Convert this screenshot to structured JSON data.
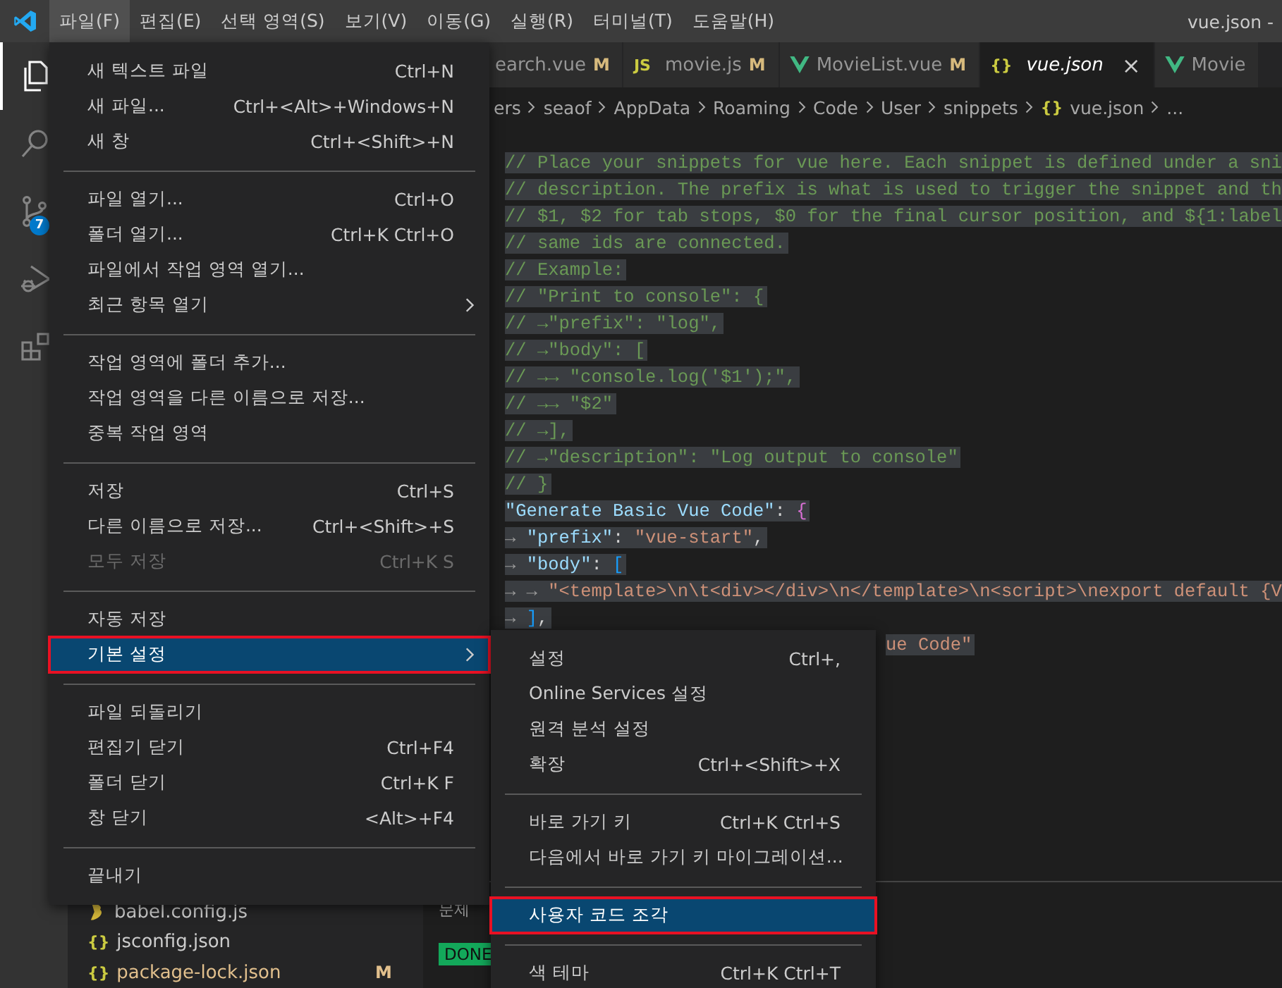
{
  "menubar": [
    {
      "label": "파일(F)",
      "selected": true
    },
    {
      "label": "편집(E)",
      "selected": false
    },
    {
      "label": "선택 영역(S)",
      "selected": false
    },
    {
      "label": "보기(V)",
      "selected": false
    },
    {
      "label": "이동(G)",
      "selected": false
    },
    {
      "label": "실행(R)",
      "selected": false
    },
    {
      "label": "터미널(T)",
      "selected": false
    },
    {
      "label": "도움말(H)",
      "selected": false
    }
  ],
  "window": {
    "title": "vue.json -"
  },
  "activity_bar": [
    {
      "kind": "files",
      "selected": true
    },
    {
      "kind": "search",
      "selected": false
    },
    {
      "kind": "scm",
      "selected": false,
      "badge": "7"
    },
    {
      "kind": "debug",
      "selected": false
    },
    {
      "kind": "extensions",
      "selected": false
    }
  ],
  "tabs": [
    {
      "label": "earch.vue",
      "status": "M",
      "kind": "plain",
      "selected": false,
      "italic": false
    },
    {
      "label": "movie.js",
      "status": "M",
      "kind": "glyph",
      "icon_text": "JS",
      "selected": false,
      "italic": false
    },
    {
      "label": "MovieList.vue",
      "status": "M",
      "kind": "vue",
      "selected": false,
      "italic": false
    },
    {
      "label": "vue.json",
      "kind": "glyph",
      "icon_text": "{}",
      "selected": true,
      "italic": true,
      "close": "×"
    },
    {
      "label": "Movie",
      "kind": "vue",
      "selected": false,
      "italic": false
    }
  ],
  "breadcrumb": [
    {
      "text": "ers"
    },
    {
      "text": "seaof"
    },
    {
      "text": "AppData"
    },
    {
      "text": "Roaming"
    },
    {
      "text": "Code"
    },
    {
      "text": "User"
    },
    {
      "text": "snippets"
    },
    {
      "text": "vue.json",
      "icon_text": "{}"
    },
    {
      "text": "..."
    }
  ],
  "code_lines": [
    {
      "tokens": [
        {
          "kind": "comment",
          "text": "// Place your snippets for vue here. Each snippet is defined under a sni"
        }
      ]
    },
    {
      "tokens": [
        {
          "kind": "comment",
          "text": "// description. The prefix is what is used to trigger the snippet and th"
        }
      ]
    },
    {
      "tokens": [
        {
          "kind": "comment",
          "text": "// $1, $2 for tab stops, $0 for the final cursor position, and ${1:label"
        }
      ]
    },
    {
      "tokens": [
        {
          "kind": "comment",
          "text": "// same ids are connected."
        }
      ]
    },
    {
      "tokens": [
        {
          "kind": "comment",
          "text": "// Example:"
        }
      ]
    },
    {
      "tokens": [
        {
          "kind": "comment",
          "text": "// \"Print to console\": {"
        }
      ]
    },
    {
      "tokens": [
        {
          "kind": "comment",
          "text": "// →\"prefix\": \"log\","
        }
      ]
    },
    {
      "tokens": [
        {
          "kind": "comment",
          "text": "// →\"body\": ["
        }
      ]
    },
    {
      "tokens": [
        {
          "kind": "comment",
          "text": "// →→ \"console.log('$1');\","
        }
      ]
    },
    {
      "tokens": [
        {
          "kind": "comment",
          "text": "// →→ \"$2\""
        }
      ]
    },
    {
      "tokens": [
        {
          "kind": "comment",
          "text": "// →],"
        }
      ]
    },
    {
      "tokens": [
        {
          "kind": "comment",
          "text": "// →\"description\": \"Log output to console\""
        }
      ]
    },
    {
      "tokens": [
        {
          "kind": "comment",
          "text": "// }"
        }
      ]
    },
    {
      "tokens": [
        {
          "kind": "key",
          "text": "\"Generate Basic Vue Code\""
        },
        {
          "kind": "punct",
          "text": ": "
        },
        {
          "kind": "brace",
          "text": "{"
        }
      ]
    },
    {
      "tokens": [
        {
          "kind": "tab",
          "text": "→ "
        },
        {
          "kind": "key",
          "text": "\"prefix\""
        },
        {
          "kind": "punct",
          "text": ": "
        },
        {
          "kind": "string",
          "text": "\"vue-start\""
        },
        {
          "kind": "punct",
          "text": ","
        }
      ]
    },
    {
      "tokens": [
        {
          "kind": "tab",
          "text": "→ "
        },
        {
          "kind": "key",
          "text": "\"body\""
        },
        {
          "kind": "punct",
          "text": ": "
        },
        {
          "kind": "bracket",
          "text": "["
        }
      ]
    },
    {
      "tokens": [
        {
          "kind": "tab",
          "text": "→ → "
        },
        {
          "kind": "string",
          "text": "\"<template>\\n\\t<div></div>\\n</template>\\n<script>\\nexport default {V"
        }
      ]
    },
    {
      "tokens": [
        {
          "kind": "tab",
          "text": "→ "
        },
        {
          "kind": "bracket",
          "text": "]"
        },
        {
          "kind": "punct",
          "text": ","
        }
      ]
    },
    {
      "covered": true,
      "tokens": [
        {
          "kind": "string",
          "text": "ue Code\""
        }
      ]
    }
  ],
  "explorer": [
    {
      "name": "babel.config.js",
      "kind": "babel"
    },
    {
      "name": "jsconfig.json",
      "kind": "glyph",
      "icon_text": "{}"
    },
    {
      "name": "package-lock.json",
      "kind": "glyph",
      "icon_text": "{}",
      "status": "M"
    }
  ],
  "panel": {
    "tab": "문제",
    "badge": "DONE"
  },
  "file_menu": [
    {
      "kind": "item",
      "label": "새 텍스트 파일",
      "shortcut": "Ctrl+N",
      "disabled": false,
      "selected": false,
      "outlined": false
    },
    {
      "kind": "item",
      "label": "새 파일...",
      "shortcut": "Ctrl+<Alt>+Windows+N",
      "disabled": false,
      "selected": false,
      "outlined": false
    },
    {
      "kind": "item",
      "label": "새 창",
      "shortcut": "Ctrl+<Shift>+N",
      "disabled": false,
      "selected": false,
      "outlined": false
    },
    {
      "kind": "separator"
    },
    {
      "kind": "item",
      "label": "파일 열기...",
      "shortcut": "Ctrl+O",
      "disabled": false,
      "selected": false,
      "outlined": false
    },
    {
      "kind": "item",
      "label": "폴더 열기...",
      "shortcut": "Ctrl+K Ctrl+O",
      "disabled": false,
      "selected": false,
      "outlined": false
    },
    {
      "kind": "item",
      "label": "파일에서 작업 영역 열기...",
      "disabled": false,
      "selected": false,
      "outlined": false
    },
    {
      "kind": "submenu",
      "label": "최근 항목 열기",
      "disabled": false,
      "selected": false,
      "outlined": false
    },
    {
      "kind": "separator"
    },
    {
      "kind": "item",
      "label": "작업 영역에 폴더 추가...",
      "disabled": false,
      "selected": false,
      "outlined": false
    },
    {
      "kind": "item",
      "label": "작업 영역을 다른 이름으로 저장...",
      "disabled": false,
      "selected": false,
      "outlined": false
    },
    {
      "kind": "item",
      "label": "중복 작업 영역",
      "disabled": false,
      "selected": false,
      "outlined": false
    },
    {
      "kind": "separator"
    },
    {
      "kind": "item",
      "label": "저장",
      "shortcut": "Ctrl+S",
      "disabled": false,
      "selected": false,
      "outlined": false
    },
    {
      "kind": "item",
      "label": "다른 이름으로 저장...",
      "shortcut": "Ctrl+<Shift>+S",
      "disabled": false,
      "selected": false,
      "outlined": false
    },
    {
      "kind": "item",
      "label": "모두 저장",
      "shortcut": "Ctrl+K S",
      "disabled": true,
      "selected": false,
      "outlined": false
    },
    {
      "kind": "separator"
    },
    {
      "kind": "item",
      "label": "자동 저장",
      "disabled": false,
      "selected": false,
      "outlined": false
    },
    {
      "kind": "submenu",
      "label": "기본 설정",
      "disabled": false,
      "selected": true,
      "outlined": true
    },
    {
      "kind": "separator"
    },
    {
      "kind": "item",
      "label": "파일 되돌리기",
      "disabled": false,
      "selected": false,
      "outlined": false
    },
    {
      "kind": "item",
      "label": "편집기 닫기",
      "shortcut": "Ctrl+F4",
      "disabled": false,
      "selected": false,
      "outlined": false
    },
    {
      "kind": "item",
      "label": "폴더 닫기",
      "shortcut": "Ctrl+K F",
      "disabled": false,
      "selected": false,
      "outlined": false
    },
    {
      "kind": "item",
      "label": "창 닫기",
      "shortcut": "<Alt>+F4",
      "disabled": false,
      "selected": false,
      "outlined": false
    },
    {
      "kind": "separator"
    },
    {
      "kind": "item",
      "label": "끝내기",
      "disabled": false,
      "selected": false,
      "outlined": false
    }
  ],
  "preferences_menu": [
    {
      "kind": "item",
      "label": "설정",
      "shortcut": "Ctrl+,",
      "disabled": false,
      "selected": false,
      "outlined": false
    },
    {
      "kind": "item",
      "label": "Online Services 설정",
      "disabled": false,
      "selected": false,
      "outlined": false
    },
    {
      "kind": "item",
      "label": "원격 분석 설정",
      "disabled": false,
      "selected": false,
      "outlined": false
    },
    {
      "kind": "item",
      "label": "확장",
      "shortcut": "Ctrl+<Shift>+X",
      "disabled": false,
      "selected": false,
      "outlined": false
    },
    {
      "kind": "separator"
    },
    {
      "kind": "item",
      "label": "바로 가기 키",
      "shortcut": "Ctrl+K Ctrl+S",
      "disabled": false,
      "selected": false,
      "outlined": false
    },
    {
      "kind": "item",
      "label": "다음에서 바로 가기 키 마이그레이션...",
      "disabled": false,
      "selected": false,
      "outlined": false
    },
    {
      "kind": "separator"
    },
    {
      "kind": "item",
      "label": "사용자 코드 조각",
      "disabled": false,
      "selected": true,
      "outlined": true
    },
    {
      "kind": "separator"
    },
    {
      "kind": "item",
      "label": "색 테마",
      "shortcut": "Ctrl+K Ctrl+T",
      "disabled": false,
      "selected": false,
      "outlined": false
    }
  ]
}
